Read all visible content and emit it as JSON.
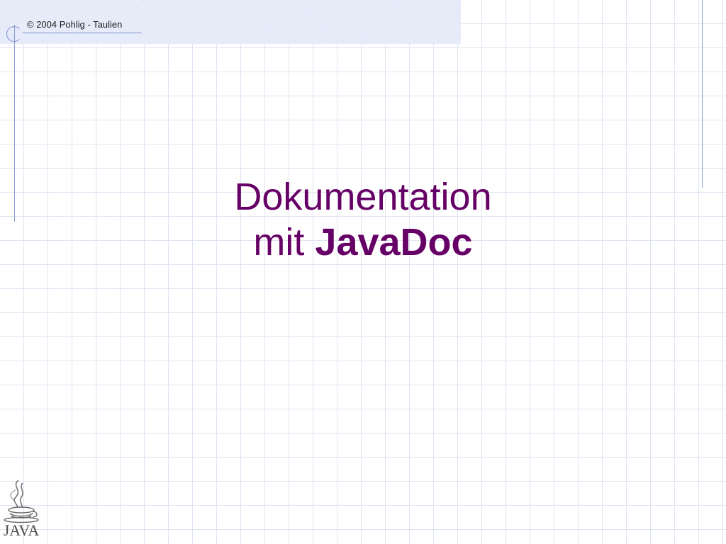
{
  "header": {
    "copyright": "© 2004 Pohlig - Taulien"
  },
  "title": {
    "line1": "Dokumentation",
    "line2_prefix": "mit ",
    "line2_strong": "JavaDoc"
  },
  "logo": {
    "icon": "java-cup-icon",
    "text": "JAVA"
  },
  "colors": {
    "title": "#660066",
    "accent_lines": "#8a9ad6",
    "grid": "#dfe4f2"
  }
}
